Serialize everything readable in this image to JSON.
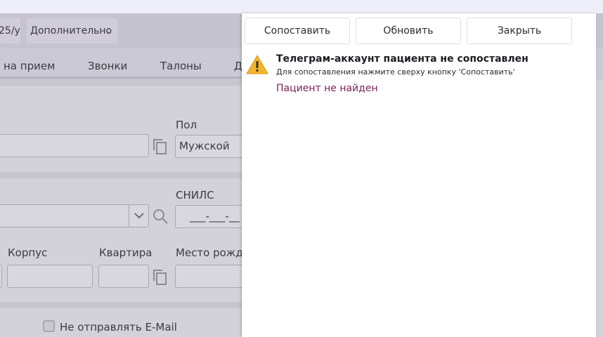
{
  "toolbar": {
    "left_button_label": "25/у",
    "more_button_label": "Дополнительно",
    "more_chevron_icon": "chevron-down-icon"
  },
  "tabs": {
    "items": [
      {
        "label": "на прием"
      },
      {
        "label": "Звонки"
      },
      {
        "label": "Талоны"
      },
      {
        "label": "Д"
      }
    ]
  },
  "form": {
    "gender": {
      "label": "Пол",
      "value": "Мужской"
    },
    "snils": {
      "label": "СНИЛС",
      "value": "___-___-__"
    },
    "building": {
      "label": "Корпус",
      "value": ""
    },
    "apartment": {
      "label": "Квартира",
      "value": ""
    },
    "birthplace": {
      "label": "Место рожде",
      "value": ""
    },
    "no_email": {
      "label": "Не отправлять E-Mail",
      "checked": false
    }
  },
  "panel": {
    "buttons": {
      "match": "Сопоставить",
      "refresh": "Обновить",
      "close": "Закрыть"
    },
    "message": {
      "icon": "warning-icon",
      "title": "Телеграм-аккаунт пациента не сопоставлен",
      "subtitle": "Для сопоставления нажмите сверху кнопку 'Сопоставить'",
      "status": "Пациент не найден",
      "status_color": "#7a1f55"
    }
  }
}
